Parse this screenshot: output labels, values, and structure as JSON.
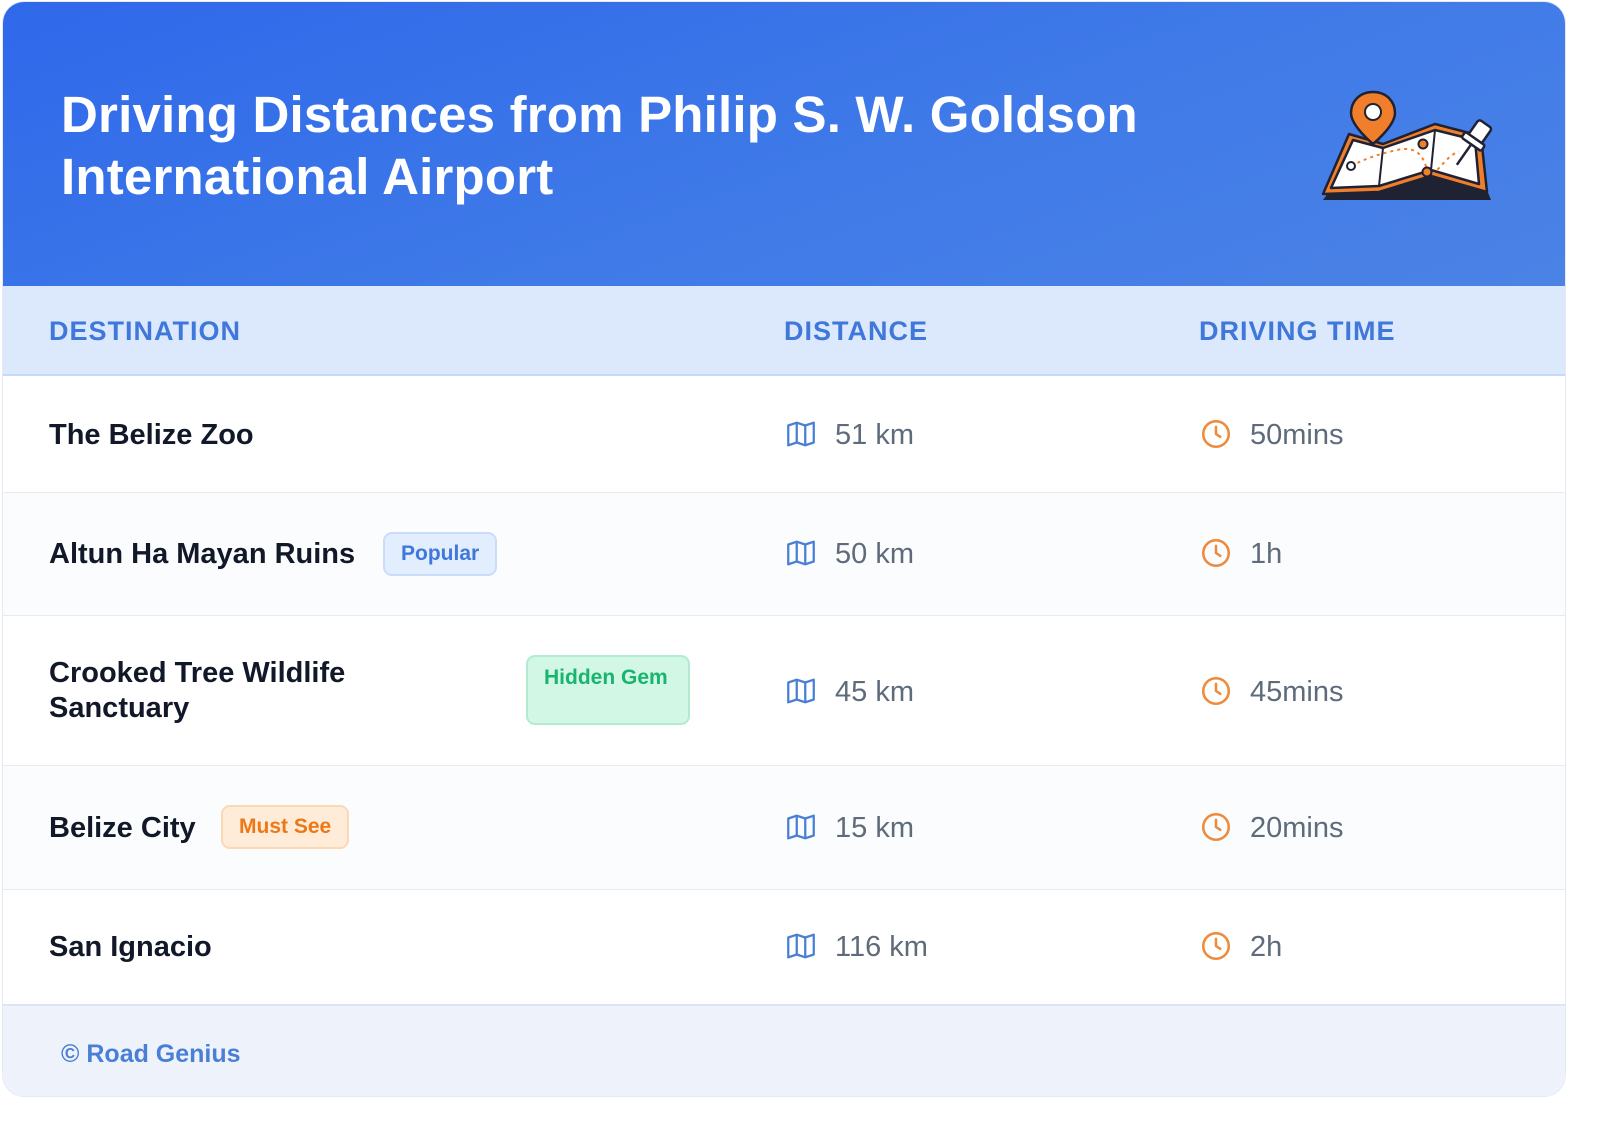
{
  "header": {
    "title": "Driving Distances from Philip S. W. Goldson International Airport",
    "illustration": "map-with-pin-icon"
  },
  "table": {
    "columns": [
      "DESTINATION",
      "DISTANCE",
      "DRIVING TIME"
    ],
    "rows": [
      {
        "destination": "The Belize Zoo",
        "badge": "",
        "distance": "51 km",
        "time": "50mins"
      },
      {
        "destination": "Altun Ha Mayan Ruins",
        "badge": "Popular",
        "distance": "50 km",
        "time": "1h"
      },
      {
        "destination": "Crooked Tree Wildlife Sanctuary",
        "badge": "Hidden Gem",
        "distance": "45 km",
        "time": "45mins"
      },
      {
        "destination": "Belize City",
        "badge": "Must See",
        "distance": "15 km",
        "time": "20mins"
      },
      {
        "destination": "San Ignacio",
        "badge": "",
        "distance": "116 km",
        "time": "2h"
      }
    ]
  },
  "icons": {
    "distance": "map-icon",
    "time": "clock-icon"
  },
  "colors": {
    "header": "#3470e8",
    "accent": "#3f78da",
    "orange": "#ee7816",
    "green": "#18b470"
  },
  "footer": {
    "credit": "© Road Genius"
  }
}
